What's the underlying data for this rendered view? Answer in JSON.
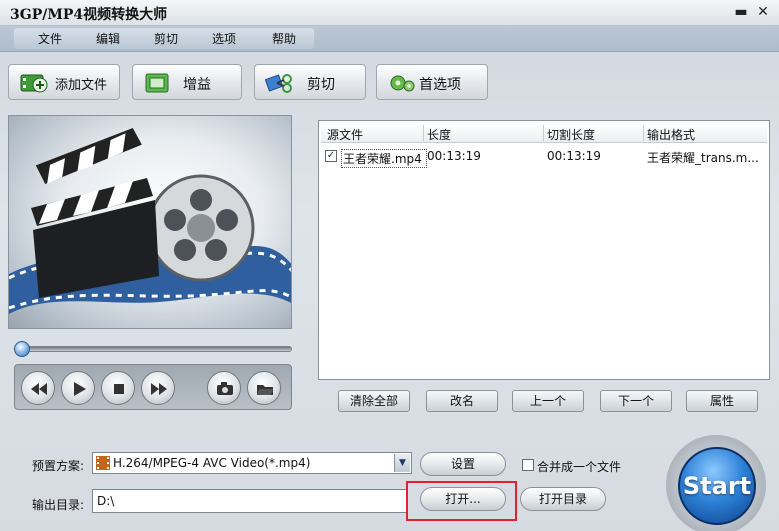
{
  "window": {
    "title": "3GP/MP4视频转换大师"
  },
  "menu": [
    "文件",
    "编辑",
    "剪切",
    "选项",
    "帮助"
  ],
  "toolbar": {
    "add_file": "添加文件",
    "gain": "增益",
    "cut": "剪切",
    "preferences": "首选项"
  },
  "filelist": {
    "columns": [
      "源文件",
      "长度",
      "切割长度",
      "输出格式"
    ],
    "rows": [
      {
        "checked": true,
        "source": "王者荣耀.mp4",
        "length": "00:13:19",
        "cut_length": "00:13:19",
        "output": "王者荣耀_trans.m..."
      }
    ]
  },
  "list_actions": {
    "clear_all": "清除全部",
    "rename": "改名",
    "prev": "上一个",
    "next": "下一个",
    "properties": "属性"
  },
  "preset": {
    "label": "预置方案:",
    "value": "H.264/MPEG-4 AVC Video(*.mp4)",
    "settings": "设置",
    "merge_label": "合并成一个文件",
    "merge_checked": false
  },
  "output": {
    "label": "输出目录:",
    "value": "D:\\",
    "open": "打开...",
    "open_dir": "打开目录"
  },
  "start": {
    "label": "Start"
  },
  "player": {
    "progress": 0.0
  },
  "colors": {
    "accent": "#2e82d8",
    "highlight": "#e2222a"
  }
}
